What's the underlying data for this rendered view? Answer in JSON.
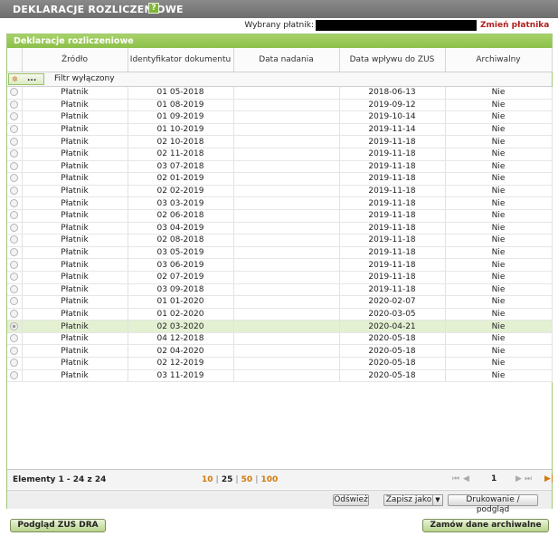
{
  "header": {
    "title": "DEKLARACJE ROZLICZENIOWE",
    "help_icon": "?"
  },
  "payer": {
    "label": "Wybrany płatnik:",
    "change_link": "Zmień płatnika"
  },
  "panel": {
    "title": "Deklaracje rozliczeniowe"
  },
  "columns": [
    "Źródło",
    "Identyfikator dokumentu",
    "Data nadania",
    "Data wpływu do ZUS",
    "Archiwalny"
  ],
  "filter": {
    "button_label": "...",
    "status": "Filtr wyłączony"
  },
  "rows": [
    {
      "source": "Płatnik",
      "id": "01 05-2018",
      "sent": "",
      "received": "2018-06-13",
      "archived": "Nie",
      "selected": false
    },
    {
      "source": "Płatnik",
      "id": "01 08-2019",
      "sent": "",
      "received": "2019-09-12",
      "archived": "Nie",
      "selected": false
    },
    {
      "source": "Płatnik",
      "id": "01 09-2019",
      "sent": "",
      "received": "2019-10-14",
      "archived": "Nie",
      "selected": false
    },
    {
      "source": "Płatnik",
      "id": "01 10-2019",
      "sent": "",
      "received": "2019-11-14",
      "archived": "Nie",
      "selected": false
    },
    {
      "source": "Płatnik",
      "id": "02 10-2018",
      "sent": "",
      "received": "2019-11-18",
      "archived": "Nie",
      "selected": false
    },
    {
      "source": "Płatnik",
      "id": "02 11-2018",
      "sent": "",
      "received": "2019-11-18",
      "archived": "Nie",
      "selected": false
    },
    {
      "source": "Płatnik",
      "id": "03 07-2018",
      "sent": "",
      "received": "2019-11-18",
      "archived": "Nie",
      "selected": false
    },
    {
      "source": "Płatnik",
      "id": "02 01-2019",
      "sent": "",
      "received": "2019-11-18",
      "archived": "Nie",
      "selected": false
    },
    {
      "source": "Płatnik",
      "id": "02 02-2019",
      "sent": "",
      "received": "2019-11-18",
      "archived": "Nie",
      "selected": false
    },
    {
      "source": "Płatnik",
      "id": "03 03-2019",
      "sent": "",
      "received": "2019-11-18",
      "archived": "Nie",
      "selected": false
    },
    {
      "source": "Płatnik",
      "id": "02 06-2018",
      "sent": "",
      "received": "2019-11-18",
      "archived": "Nie",
      "selected": false
    },
    {
      "source": "Płatnik",
      "id": "03 04-2019",
      "sent": "",
      "received": "2019-11-18",
      "archived": "Nie",
      "selected": false
    },
    {
      "source": "Płatnik",
      "id": "02 08-2018",
      "sent": "",
      "received": "2019-11-18",
      "archived": "Nie",
      "selected": false
    },
    {
      "source": "Płatnik",
      "id": "03 05-2019",
      "sent": "",
      "received": "2019-11-18",
      "archived": "Nie",
      "selected": false
    },
    {
      "source": "Płatnik",
      "id": "03 06-2019",
      "sent": "",
      "received": "2019-11-18",
      "archived": "Nie",
      "selected": false
    },
    {
      "source": "Płatnik",
      "id": "02 07-2019",
      "sent": "",
      "received": "2019-11-18",
      "archived": "Nie",
      "selected": false
    },
    {
      "source": "Płatnik",
      "id": "03 09-2018",
      "sent": "",
      "received": "2019-11-18",
      "archived": "Nie",
      "selected": false
    },
    {
      "source": "Płatnik",
      "id": "01 01-2020",
      "sent": "",
      "received": "2020-02-07",
      "archived": "Nie",
      "selected": false
    },
    {
      "source": "Płatnik",
      "id": "01 02-2020",
      "sent": "",
      "received": "2020-03-05",
      "archived": "Nie",
      "selected": false
    },
    {
      "source": "Płatnik",
      "id": "02 03-2020",
      "sent": "",
      "received": "2020-04-21",
      "archived": "Nie",
      "selected": true
    },
    {
      "source": "Płatnik",
      "id": "04 12-2018",
      "sent": "",
      "received": "2020-05-18",
      "archived": "Nie",
      "selected": false
    },
    {
      "source": "Płatnik",
      "id": "02 04-2020",
      "sent": "",
      "received": "2020-05-18",
      "archived": "Nie",
      "selected": false
    },
    {
      "source": "Płatnik",
      "id": "02 12-2019",
      "sent": "",
      "received": "2020-05-18",
      "archived": "Nie",
      "selected": false
    },
    {
      "source": "Płatnik",
      "id": "03 11-2019",
      "sent": "",
      "received": "2020-05-18",
      "archived": "Nie",
      "selected": false
    }
  ],
  "footer": {
    "items_count": "Elementy 1 - 24 z 24",
    "page_sizes": [
      "10",
      "25",
      "50",
      "100"
    ],
    "active_page_size": "25",
    "current_page": "1",
    "pager_first": "⏮",
    "pager_prev": "◀",
    "pager_next": "▶",
    "pager_last": "⏭",
    "pager_export": "▶|"
  },
  "actions": {
    "refresh": "Odśwież",
    "save_as": "Zapisz jako",
    "print": "Drukowanie / podgląd"
  },
  "bottom": {
    "preview": "Podgląd ZUS DRA",
    "order_archive": "Zamów dane archiwalne"
  },
  "colors": {
    "accent_green": "#8cbf4a",
    "link_red": "#b02020",
    "orange": "#d07a10"
  }
}
